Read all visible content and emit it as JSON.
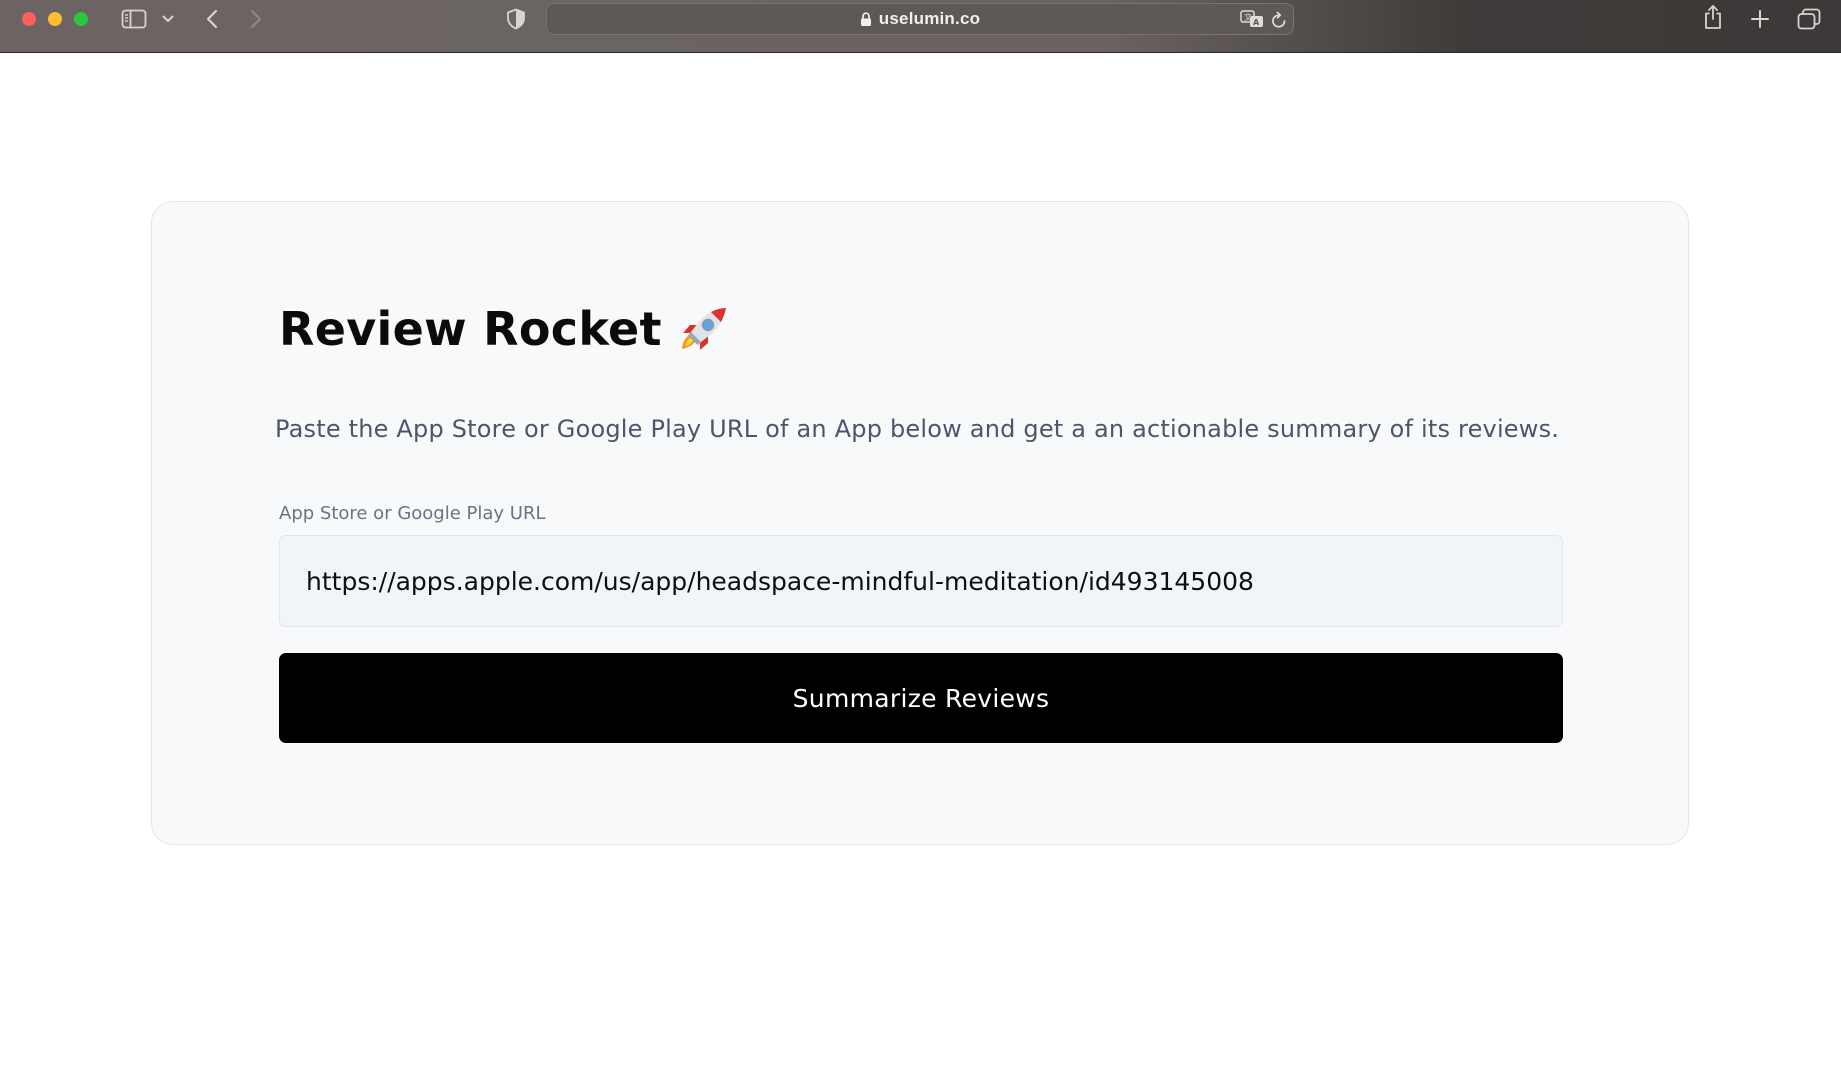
{
  "browser": {
    "url_host": "uselumin.co",
    "icons": {
      "sidebar": "sidebar-icon",
      "chevron": "chevron-down-icon",
      "back": "back-arrow-icon",
      "forward": "forward-arrow-icon",
      "shield": "privacy-shield-icon",
      "lock": "lock-icon",
      "translate": "translate-icon",
      "reload": "reload-icon",
      "share": "share-icon",
      "new_tab": "plus-icon",
      "tab_overview": "tabs-overview-icon"
    }
  },
  "page": {
    "title": "Review Rocket",
    "title_icon": "rocket-icon",
    "subtitle": "Paste the App Store or Google Play URL of an App below and get a an actionable summary of its reviews.",
    "url_field": {
      "label": "App Store or Google Play URL",
      "value": "https://apps.apple.com/us/app/headspace-mindful-meditation/id493145008"
    },
    "submit_label": "Summarize Reviews"
  },
  "colors": {
    "card_background": "#f8f9fb",
    "button_background": "#000000",
    "subtitle_text": "#4d5669",
    "label_text": "#6b7282"
  }
}
